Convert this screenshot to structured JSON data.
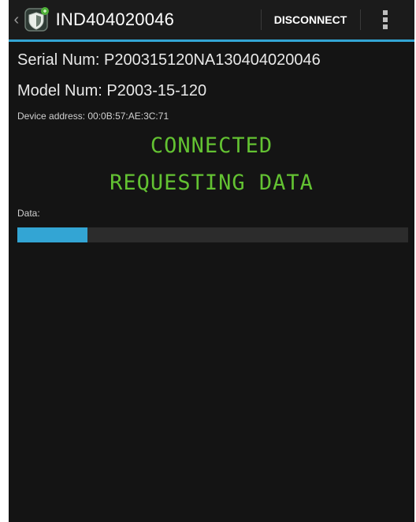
{
  "actionbar": {
    "title": "IND404020046",
    "disconnect_label": "DISCONNECT",
    "icons": {
      "up": "chevron-left-icon",
      "app": "shield-icon",
      "overflow": "overflow-menu-icon"
    },
    "accent_color": "#33A5D4"
  },
  "device": {
    "serial": "Serial Num: P200315120NA130404020046",
    "model": "Model Num: P2003-15-120",
    "address": "Device address: 00:0B:57:AE:3C:71"
  },
  "status": {
    "connection": "CONNECTED",
    "activity": "REQUESTING DATA",
    "color": "#63C232"
  },
  "progress": {
    "label": "Data:",
    "fraction": 0.18,
    "fill_color": "#33A5D4"
  }
}
